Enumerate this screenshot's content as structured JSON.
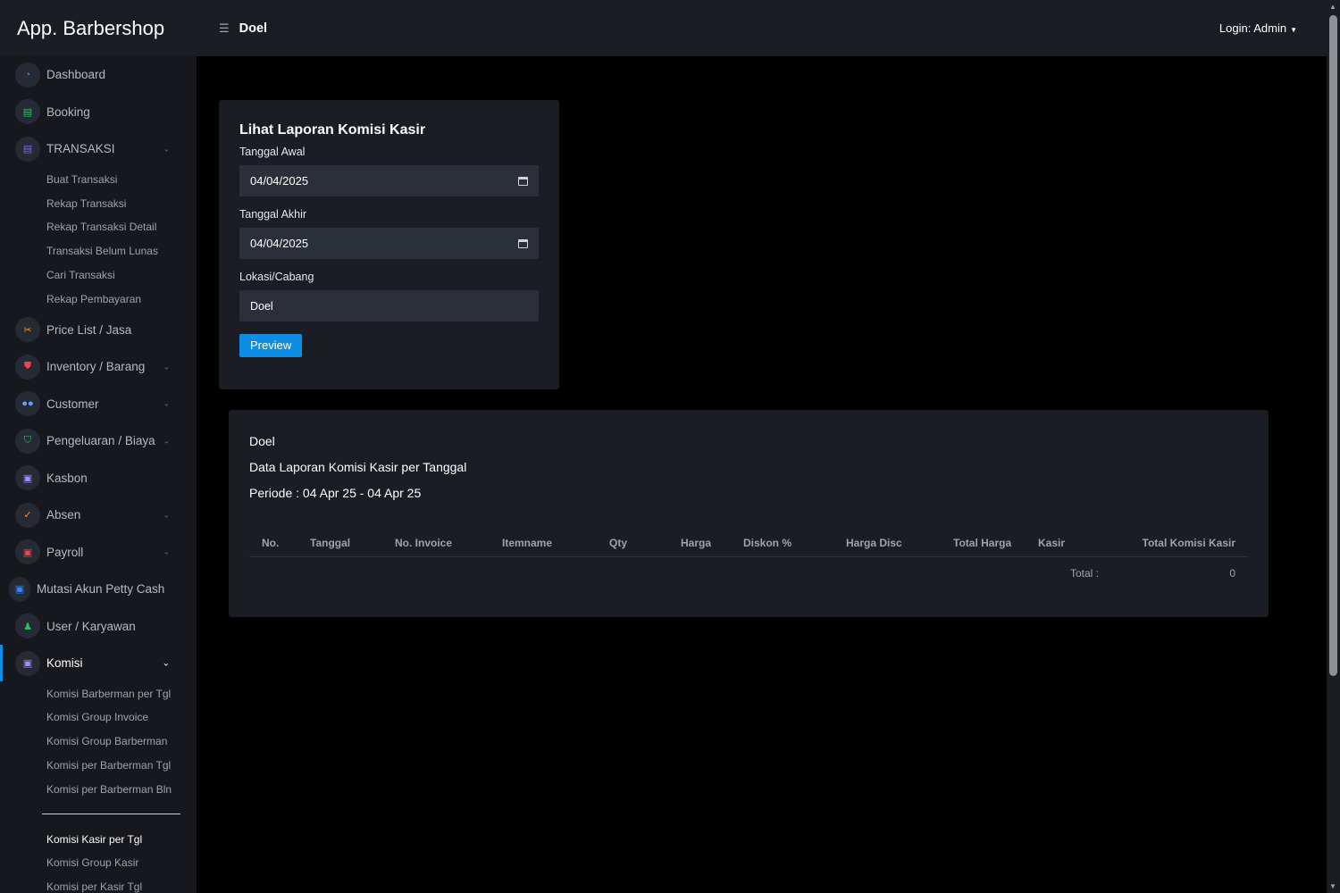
{
  "app": {
    "title": "App. Barbershop"
  },
  "header": {
    "breadcrumb": "Doel",
    "login_label": "Login: Admin"
  },
  "sidebar": {
    "items": [
      {
        "label": "Dashboard",
        "icon": "gauge-icon",
        "icon_color": "#3b82f6"
      },
      {
        "label": "Booking",
        "icon": "document-icon",
        "icon_color": "#22c55e"
      },
      {
        "label": "TRANSAKSI",
        "icon": "receipt-icon",
        "icon_color": "#8b5cf6"
      },
      {
        "label": "Price List / Jasa",
        "icon": "scissors-icon",
        "icon_color": "#f59e0b"
      },
      {
        "label": "Inventory / Barang",
        "icon": "shield-icon",
        "icon_color": "#ef4444"
      },
      {
        "label": "Customer",
        "icon": "users-icon",
        "icon_color": "#60a5fa"
      },
      {
        "label": "Pengeluaran / Biaya",
        "icon": "shield-check-icon",
        "icon_color": "#22c55e"
      },
      {
        "label": "Kasbon",
        "icon": "money-icon",
        "icon_color": "#a78bfa"
      },
      {
        "label": "Absen",
        "icon": "check-icon",
        "icon_color": "#fb923c"
      },
      {
        "label": "Payroll",
        "icon": "payroll-icon",
        "icon_color": "#ef4444"
      },
      {
        "label": "Mutasi Akun Petty Cash",
        "icon": "petty-cash-icon",
        "icon_color": "#3b82f6"
      },
      {
        "label": "User / Karyawan",
        "icon": "user-icon",
        "icon_color": "#22c55e"
      },
      {
        "label": "Komisi",
        "icon": "commission-icon",
        "icon_color": "#a78bfa"
      }
    ],
    "transaksi_sub": [
      "Buat Transaksi",
      "Rekap Transaksi",
      "Rekap Transaksi Detail",
      "Transaksi Belum Lunas",
      "Cari Transaksi",
      "Rekap Pembayaran"
    ],
    "komisi_sub": [
      "Komisi Barberman per Tgl",
      "Komisi Group Invoice",
      "Komisi Group Barberman",
      "Komisi per Barberman Tgl",
      "Komisi per Barberman Bln"
    ],
    "komisi_sub2": [
      "Komisi Kasir per Tgl",
      "Komisi Group Kasir",
      "Komisi per Kasir Tgl"
    ]
  },
  "form": {
    "title": "Lihat Laporan Komisi Kasir",
    "start_label": "Tanggal Awal",
    "start_value": "04/04/2025",
    "end_label": "Tanggal Akhir",
    "end_value": "04/04/2025",
    "location_label": "Lokasi/Cabang",
    "location_value": "Doel",
    "preview_label": "Preview"
  },
  "report": {
    "branch": "Doel",
    "heading": "Data Laporan Komisi Kasir per Tanggal",
    "period": "Periode : 04 Apr 25 - 04 Apr 25",
    "columns": [
      "No.",
      "Tanggal",
      "No. Invoice",
      "Itemname",
      "Qty",
      "Harga",
      "Diskon %",
      "Harga Disc",
      "Total Harga",
      "Kasir",
      "Total Komisi Kasir"
    ],
    "total_label": "Total :",
    "total_value": "0"
  },
  "colors": {
    "accent": "#0d8ee4",
    "panel": "#1a1d24",
    "sidebar": "#16181d",
    "background": "#000000"
  }
}
